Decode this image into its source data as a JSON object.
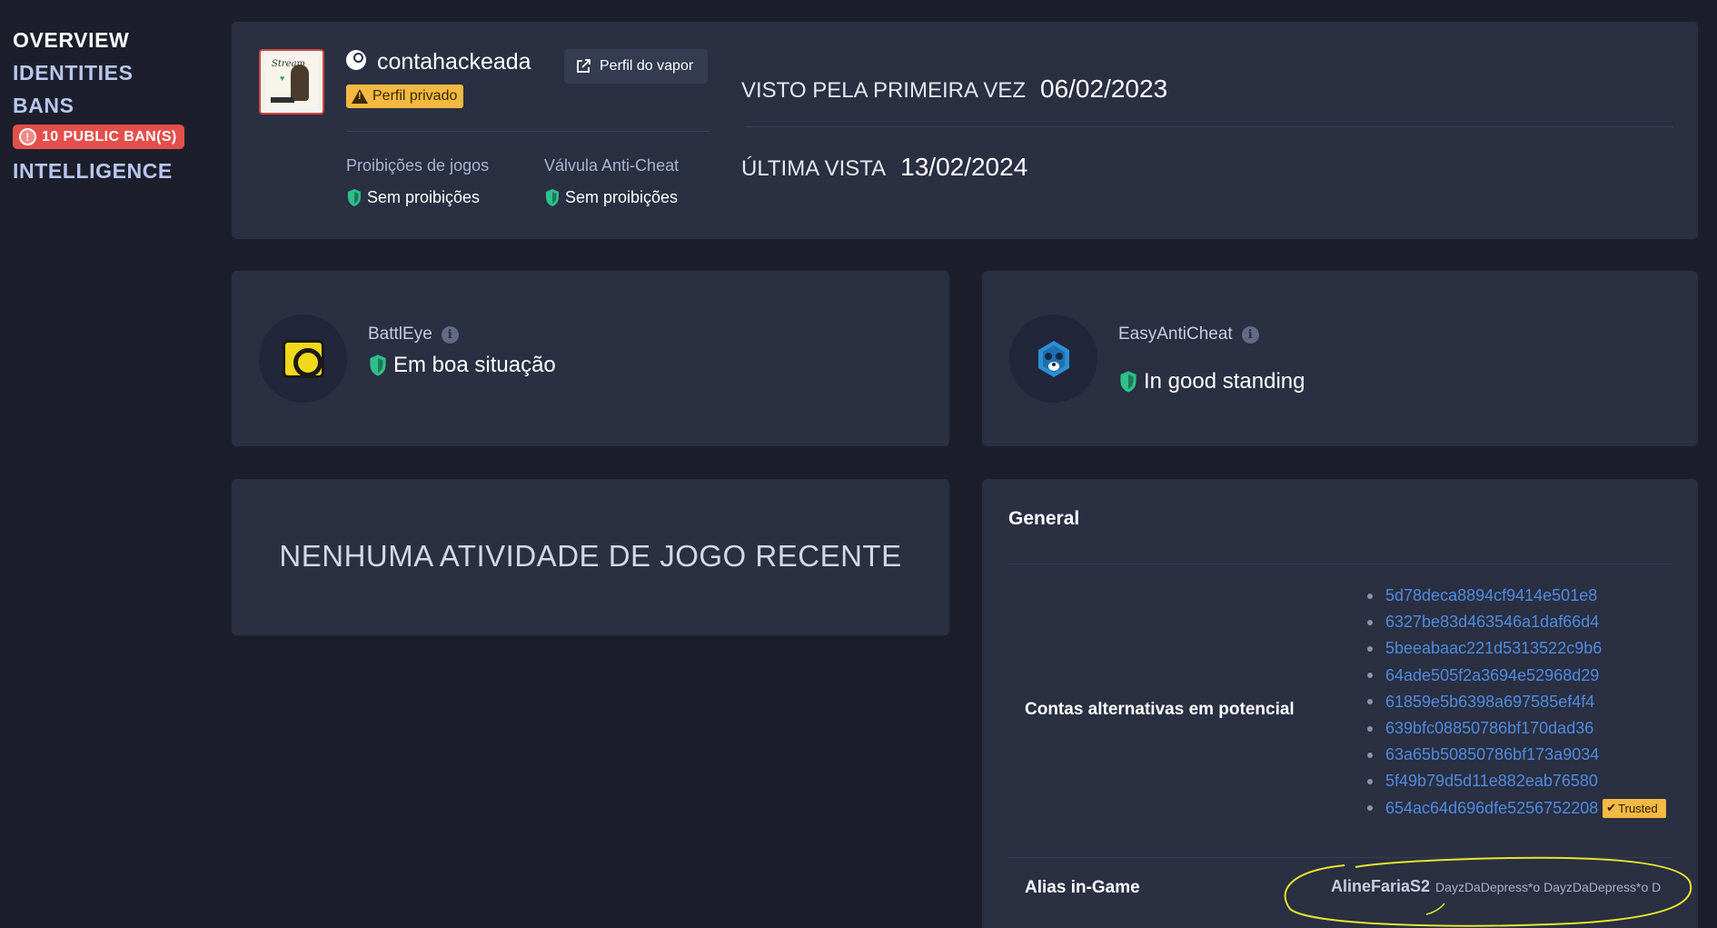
{
  "sidebar": {
    "items": [
      {
        "label": "OVERVIEW"
      },
      {
        "label": "IDENTITIES"
      },
      {
        "label": "BANS"
      },
      {
        "label": "INTELLIGENCE"
      }
    ],
    "ban_badge": "10 PUBLIC BAN(S)"
  },
  "profile": {
    "username": "contahackeada",
    "private_label": "Perfil privado",
    "steam_profile_button": "Perfil do vapor",
    "game_bans_label": "Proibições de jogos",
    "game_bans_status": "Sem proibições",
    "vac_label": "Válvula Anti-Cheat",
    "vac_status": "Sem proibições",
    "first_seen_label": "VISTO PELA PRIMEIRA VEZ",
    "first_seen_date": "06/02/2023",
    "last_seen_label": "ÚLTIMA VISTA",
    "last_seen_date": "13/02/2024"
  },
  "anticheat": {
    "battleye": {
      "name": "BattlEye",
      "status": "Em boa situação"
    },
    "eac": {
      "name": "EasyAntiCheat",
      "status": "In good standing"
    }
  },
  "activity": {
    "empty_text": "NENHUMA ATIVIDADE DE JOGO RECENTE"
  },
  "general": {
    "title": "General",
    "alt_accounts_label": "Contas alternativas em potencial",
    "alt_accounts": [
      "5d78deca8894cf9414e501e8",
      "6327be83d463546a1daf66d4",
      "5beeabaac221d5313522c9b6",
      "64ade505f2a3694e52968d29",
      "61859e5b6398a697585ef4f4",
      "639bfc08850786bf170dad36",
      "63a65b50850786bf173a9034",
      "5f49b79d5d11e882eab76580",
      "654ac64d696dfe5256752208"
    ],
    "trusted_label": "Trusted",
    "alias_label": "Alias in-Game",
    "alias_main": "AlineFariaS2",
    "alias_others": "DayzDaDepress*o  DayzDaDepress*o  D"
  },
  "colors": {
    "background": "#1c1f2b",
    "card": "#2a2f42",
    "accent_link": "#4e8be0",
    "ban_badge": "#e3504b",
    "warning": "#f4b942",
    "good_shield": "#2fbf8a",
    "annotation": "#e6e62e"
  },
  "icons": [
    "steam-icon",
    "warning-icon",
    "external-link-icon",
    "shield-check-icon",
    "info-icon",
    "battleye-logo",
    "easyanticheat-logo",
    "check-icon"
  ]
}
